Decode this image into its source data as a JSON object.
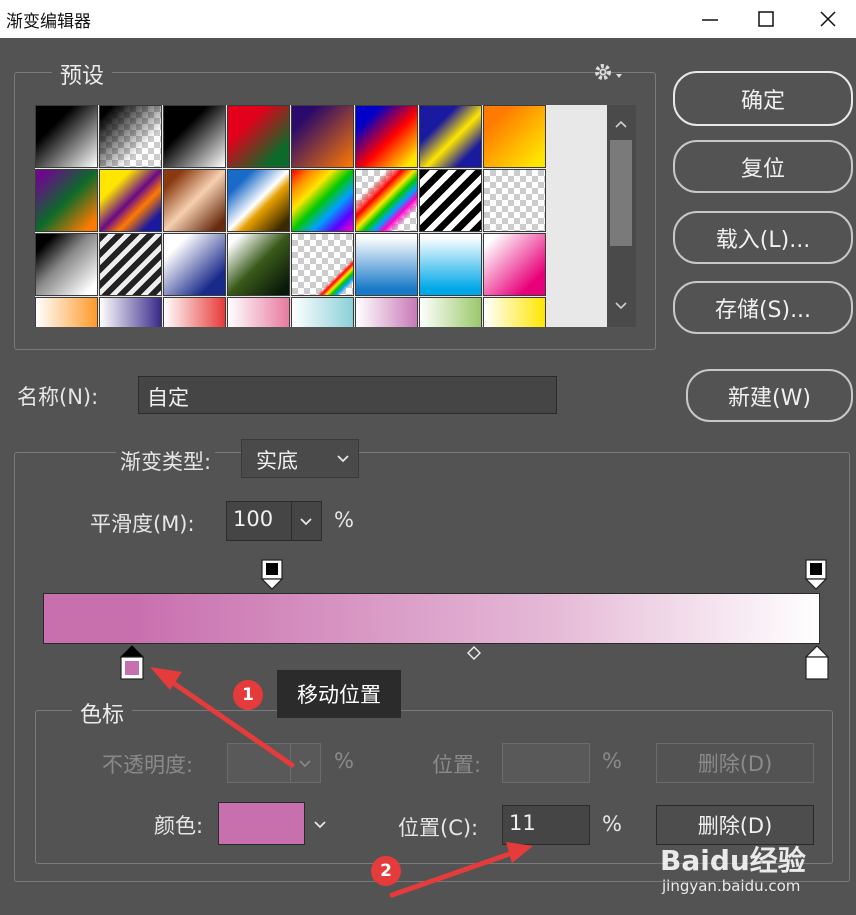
{
  "window": {
    "title": "渐变编辑器"
  },
  "presets": {
    "legend": "预设"
  },
  "buttons": {
    "ok": "确定",
    "reset": "复位",
    "load": "载入(L)...",
    "save": "存储(S)...",
    "new": "新建(W)"
  },
  "name": {
    "label": "名称(N):",
    "value": "自定"
  },
  "gradient": {
    "type_label": "渐变类型:",
    "type_value": "实底",
    "smooth_label": "平滑度(M):",
    "smooth_value": "100",
    "percent": "%"
  },
  "stops": {
    "legend": "色标",
    "opacity_label": "不透明度:",
    "opacity_percent": "%",
    "opacity_location_label": "位置:",
    "opacity_location_percent": "%",
    "delete_disabled": "删除(D)",
    "color_label": "颜色:",
    "color_value": "#c86fae",
    "location_label": "位置(C):",
    "location_value": "11",
    "location_percent": "%",
    "delete": "删除(D)"
  },
  "annotations": {
    "tooltip": "移动位置",
    "badge1": "1",
    "badge2": "2",
    "marker_color": "#e63b3b"
  },
  "watermark": {
    "brand": "Baidu经验",
    "url": "jingyan.baidu.com"
  }
}
